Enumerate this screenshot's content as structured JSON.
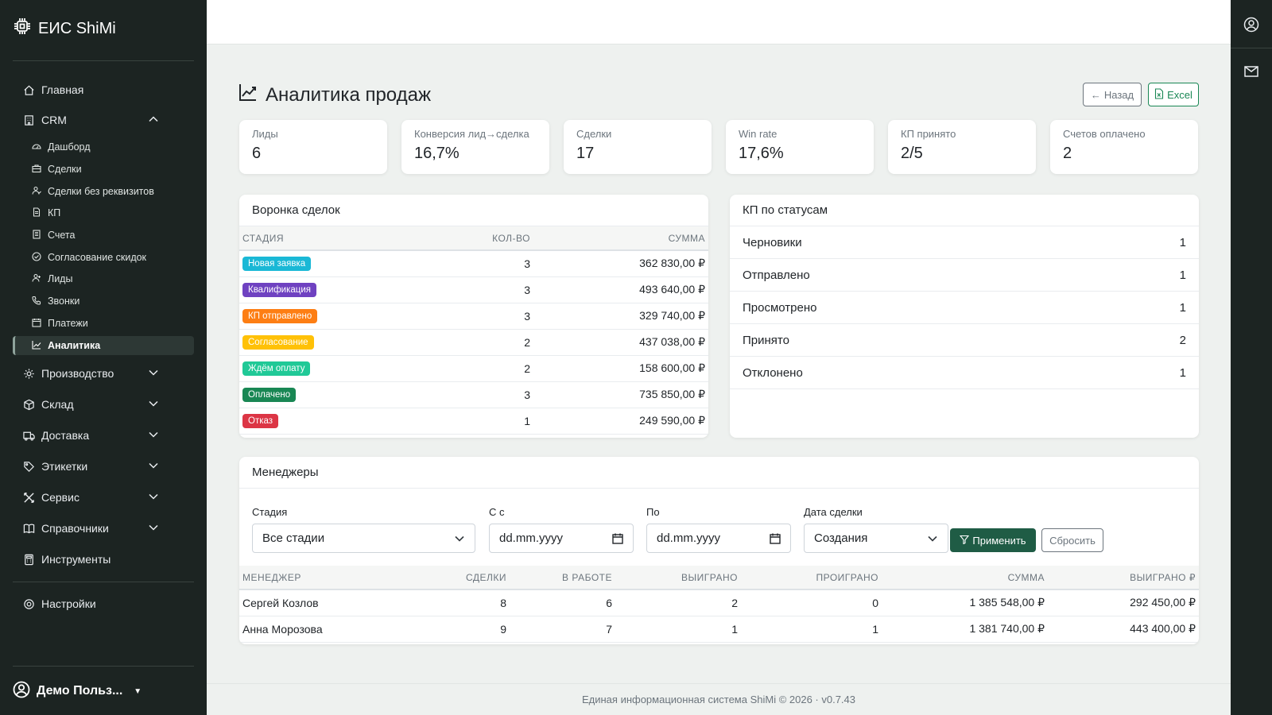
{
  "brand": {
    "name": "ЕИС ShiMi"
  },
  "sidebar": {
    "main": {
      "label": "Главная"
    },
    "crm": {
      "label": "CRM",
      "items": [
        {
          "label": "Дашборд",
          "icon": "dashboard-icon"
        },
        {
          "label": "Сделки",
          "icon": "briefcase-icon"
        },
        {
          "label": "Сделки без реквизитов",
          "icon": "person-check-icon"
        },
        {
          "label": "КП",
          "icon": "file-icon"
        },
        {
          "label": "Счета",
          "icon": "receipt-icon"
        },
        {
          "label": "Согласование скидок",
          "icon": "check-circle-icon"
        },
        {
          "label": "Лиды",
          "icon": "person-add-icon"
        },
        {
          "label": "Звонки",
          "icon": "phone-icon"
        },
        {
          "label": "Платежи",
          "icon": "calendar-icon"
        },
        {
          "label": "Аналитика",
          "icon": "graph-icon"
        }
      ]
    },
    "groups": [
      {
        "label": "Производство"
      },
      {
        "label": "Склад"
      },
      {
        "label": "Доставка"
      },
      {
        "label": "Этикетки"
      },
      {
        "label": "Сервис"
      },
      {
        "label": "Справочники"
      }
    ],
    "tools": {
      "label": "Инструменты"
    },
    "settings": {
      "label": "Настройки"
    },
    "user": {
      "name": "Демо Польз..."
    }
  },
  "page": {
    "title": "Аналитика продаж",
    "back_label": "Назад",
    "excel_label": "Excel"
  },
  "kpis": [
    {
      "label": "Лиды",
      "value": "6"
    },
    {
      "label": "Конверсия лид→сделка",
      "value": "16,7%"
    },
    {
      "label": "Сделки",
      "value": "17"
    },
    {
      "label": "Win rate",
      "value": "17,6%"
    },
    {
      "label": "КП принято",
      "value": "2/5"
    },
    {
      "label": "Счетов оплачено",
      "value": "2"
    }
  ],
  "funnel": {
    "title": "Воронка сделок",
    "headers": [
      "СТАДИЯ",
      "КОЛ-ВО",
      "СУММА"
    ],
    "rows": [
      {
        "stage": "Новая заявка",
        "color": "#1ab8d6",
        "count": "3",
        "sum": "362 830,00 ₽"
      },
      {
        "stage": "Квалификация",
        "color": "#6f42c1",
        "count": "3",
        "sum": "493 640,00 ₽"
      },
      {
        "stage": "КП отправлено",
        "color": "#fd7e14",
        "count": "3",
        "sum": "329 740,00 ₽"
      },
      {
        "stage": "Согласование",
        "color": "#ffc107",
        "count": "2",
        "sum": "437 038,00 ₽"
      },
      {
        "stage": "Ждём оплату",
        "color": "#20c997",
        "count": "2",
        "sum": "158 600,00 ₽"
      },
      {
        "stage": "Оплачено",
        "color": "#198754",
        "count": "3",
        "sum": "735 850,00 ₽"
      },
      {
        "stage": "Отказ",
        "color": "#dc3545",
        "count": "1",
        "sum": "249 590,00 ₽"
      }
    ]
  },
  "kp_status": {
    "title": "КП по статусам",
    "rows": [
      {
        "label": "Черновики",
        "value": "1"
      },
      {
        "label": "Отправлено",
        "value": "1"
      },
      {
        "label": "Просмотрено",
        "value": "1"
      },
      {
        "label": "Принято",
        "value": "2"
      },
      {
        "label": "Отклонено",
        "value": "1"
      }
    ]
  },
  "managers": {
    "title": "Менеджеры",
    "filters": {
      "stage_label": "Стадия",
      "stage_value": "Все стадии",
      "from_label": "С с",
      "from_value": "dd.mm.yyyy",
      "to_label": "По",
      "to_value": "dd.mm.yyyy",
      "date_label": "Дата сделки",
      "date_value": "Создания",
      "apply_label": "Применить",
      "reset_label": "Сбросить"
    },
    "headers": [
      "МЕНЕДЖЕР",
      "СДЕЛКИ",
      "В РАБОТЕ",
      "ВЫИГРАНО",
      "ПРОИГРАНО",
      "СУММА",
      "ВЫИГРАНО ₽"
    ],
    "rows": [
      {
        "name": "Сергей Козлов",
        "deals": "8",
        "in_work": "6",
        "won": "2",
        "lost": "0",
        "sum": "1 385 548,00 ₽",
        "won_sum": "292 450,00 ₽"
      },
      {
        "name": "Анна Морозова",
        "deals": "9",
        "in_work": "7",
        "won": "1",
        "lost": "1",
        "sum": "1 381 740,00 ₽",
        "won_sum": "443 400,00 ₽"
      }
    ]
  },
  "footer": {
    "text": "Единая информационная система ShiMi © 2026 · v0.7.43"
  }
}
